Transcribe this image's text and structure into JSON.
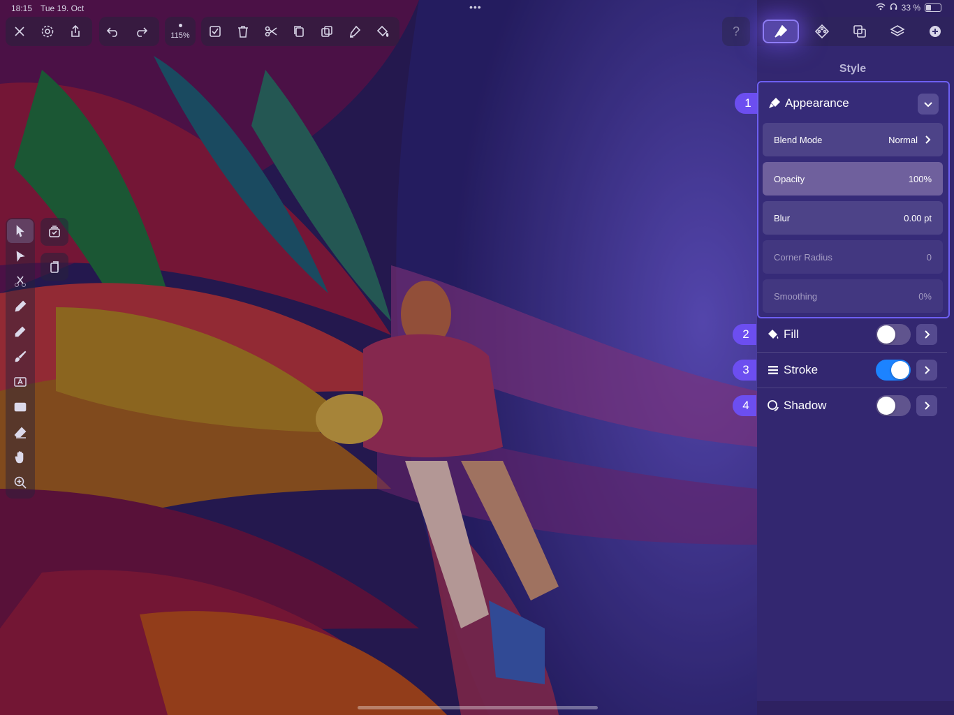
{
  "status_bar": {
    "time": "18:15",
    "date": "Tue 19. Oct",
    "dots": "•••",
    "battery_text": "33 %",
    "battery_level": 0.33
  },
  "toolbar": {
    "zoom_label": "115%",
    "icons": [
      "close-icon",
      "settings-icon",
      "share-icon",
      "undo-icon",
      "redo-icon",
      "select-all-icon",
      "delete-icon",
      "cut-icon",
      "copy-icon",
      "duplicate-icon",
      "style-picker-icon",
      "fill-bucket-icon"
    ]
  },
  "left_tools": [
    "select-arrow-icon",
    "node-arrow-icon",
    "scissors-icon",
    "pen-icon",
    "pencil-icon",
    "brush-icon",
    "text-icon",
    "rectangle-icon",
    "eraser-icon",
    "hand-icon",
    "zoom-icon"
  ],
  "tabs": {
    "help_label": "?",
    "items": [
      "style-tab",
      "path-tab",
      "arrange-tab",
      "layers-tab",
      "add-tab"
    ]
  },
  "panel": {
    "title": "Style",
    "appearance": {
      "badge": "1",
      "label": "Appearance",
      "rows": [
        {
          "label": "Blend Mode",
          "value": "Normal"
        },
        {
          "label": "Opacity",
          "value": "100%"
        },
        {
          "label": "Blur",
          "value": "0.00 pt"
        },
        {
          "label": "Corner Radius",
          "value": "0"
        },
        {
          "label": "Smoothing",
          "value": "0%"
        }
      ]
    },
    "fill": {
      "badge": "2",
      "label": "Fill",
      "on": false
    },
    "stroke": {
      "badge": "3",
      "label": "Stroke",
      "on": true
    },
    "shadow": {
      "badge": "4",
      "label": "Shadow",
      "on": false
    }
  },
  "colors": {
    "accent": "#6c4ef0",
    "switch_on": "#1c83ff",
    "panel_border": "#6d5ff2"
  }
}
